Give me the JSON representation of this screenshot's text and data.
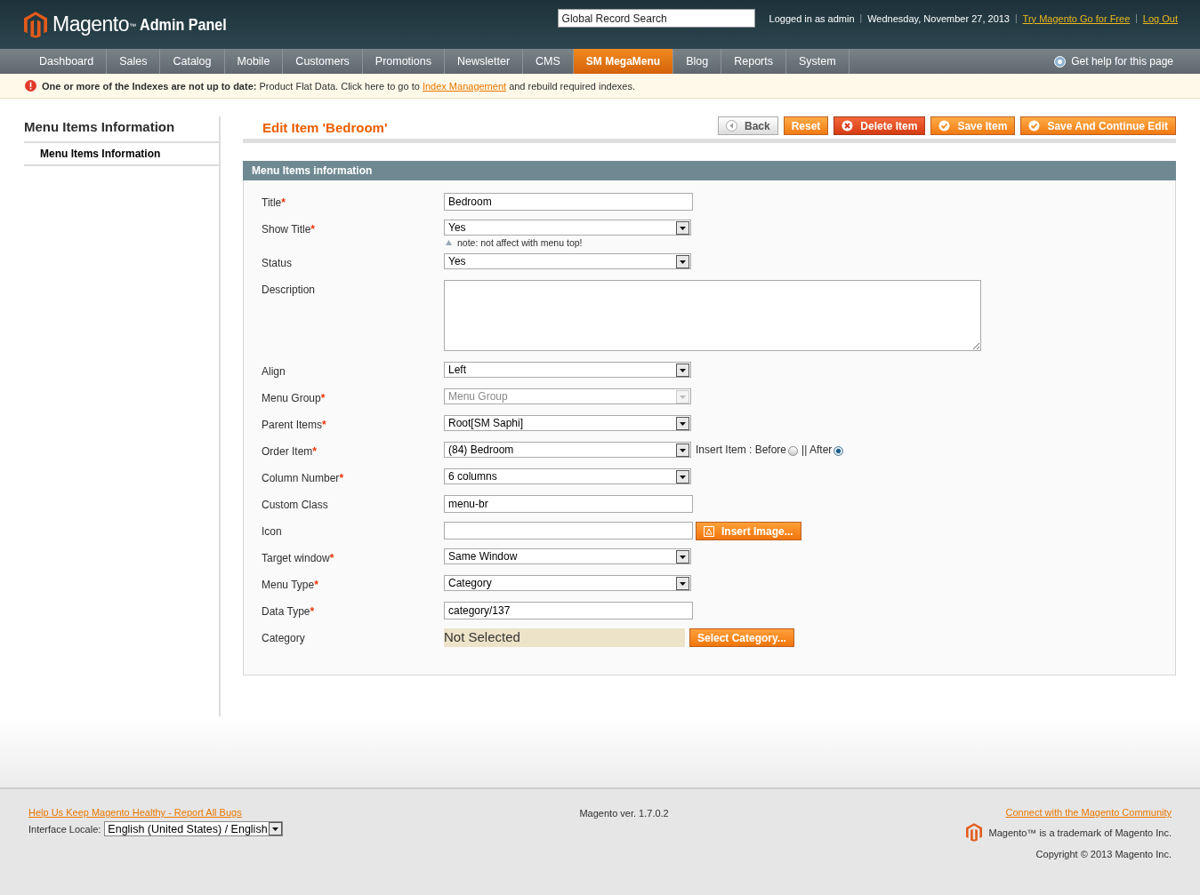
{
  "header": {
    "logo": {
      "brand": "Magento",
      "mark": "™",
      "product": "Admin Panel"
    },
    "search": {
      "placeholder": "Global Record Search"
    },
    "logged_in": "Logged in as admin",
    "date": "Wednesday, November 27, 2013",
    "links": [
      "Try Magento Go for Free",
      "Log Out"
    ],
    "separator": "|"
  },
  "nav": {
    "items": [
      {
        "label": "Dashboard",
        "selected": false
      },
      {
        "label": "Sales",
        "selected": false
      },
      {
        "label": "Catalog",
        "selected": false
      },
      {
        "label": "Mobile",
        "selected": false
      },
      {
        "label": "Customers",
        "selected": false
      },
      {
        "label": "Promotions",
        "selected": false
      },
      {
        "label": "Newsletter",
        "selected": false
      },
      {
        "label": "CMS",
        "selected": false
      },
      {
        "label": "SM MegaMenu",
        "selected": true
      },
      {
        "label": "Blog",
        "selected": false
      },
      {
        "label": "Reports",
        "selected": false
      },
      {
        "label": "System",
        "selected": false
      }
    ],
    "help": "Get help for this page"
  },
  "notice": {
    "text": "**One or more of the Indexes are not up to date:** Product Flat Data. Click here to go to",
    "link": "Index Management",
    "after": "and rebuild required indexes."
  },
  "sidebar": {
    "title": "Menu Items Information",
    "tabs": [
      {
        "label": "Menu Items Information",
        "selected": true
      }
    ]
  },
  "page": {
    "title": "Edit Item 'Bedroom'",
    "buttons": [
      {
        "label": "Back",
        "kind": "back"
      },
      {
        "label": "Reset",
        "kind": "reset"
      },
      {
        "label": "Delete Item",
        "kind": "delete"
      },
      {
        "label": "Save Item",
        "kind": "save"
      },
      {
        "label": "Save And Continue Edit",
        "kind": "save"
      }
    ]
  },
  "form": {
    "title": "Menu Items information",
    "required_mark": "*",
    "fields": [
      {
        "label": "Title",
        "required": true,
        "kind": "text",
        "value": "Bedroom"
      },
      {
        "label": "Show Title",
        "required": true,
        "kind": "select",
        "value": "Yes",
        "disabled": false,
        "note": "note: not affect with menu top!"
      },
      {
        "label": "Status",
        "required": false,
        "kind": "select",
        "value": "Yes",
        "disabled": false
      },
      {
        "label": "Description",
        "required": false,
        "kind": "textarea"
      },
      {
        "label": "Align",
        "required": false,
        "kind": "select",
        "value": "Left",
        "disabled": false
      },
      {
        "label": "Menu Group",
        "required": true,
        "kind": "select",
        "value": "Menu Group",
        "disabled": true
      },
      {
        "label": "Parent Items",
        "required": true,
        "kind": "select",
        "value": "Root[SM Saphi]",
        "disabled": false
      },
      {
        "label": "Order Item",
        "required": true,
        "kind": "select",
        "value": "(84) Bedroom",
        "disabled": false,
        "options": [
          {
            "label": "Insert Item : Before",
            "selected": false
          },
          {
            "label": "|| After",
            "selected": true
          }
        ]
      },
      {
        "label": "Column Number",
        "required": true,
        "kind": "select",
        "value": "6 columns",
        "disabled": false
      },
      {
        "label": "Custom Class",
        "required": false,
        "kind": "text",
        "value": "menu-br"
      },
      {
        "label": "Icon",
        "required": false,
        "kind": "image",
        "button": "Insert Image..."
      },
      {
        "label": "Target window",
        "required": true,
        "kind": "select",
        "value": "Same Window",
        "disabled": false
      },
      {
        "label": "Menu Type",
        "required": true,
        "kind": "select",
        "value": "Category",
        "disabled": false
      },
      {
        "label": "Data Type",
        "required": true,
        "kind": "text",
        "value": "category/137"
      },
      {
        "label": "Category",
        "required": false,
        "kind": "chooser",
        "value": "Not Selected",
        "button": "Select Category..."
      }
    ]
  },
  "footer": {
    "bug_link": "Help Us Keep Magento Healthy - Report All Bugs",
    "locale_label": "Interface Locale:",
    "locale": "English (United States) / English",
    "version": "Magento ver. 1.7.0.2",
    "community_link": "Connect with the Magento Community",
    "trademark": "Magento™ is a trademark of Magento Inc.",
    "copyright": "Copyright © 2013 Magento Inc."
  }
}
